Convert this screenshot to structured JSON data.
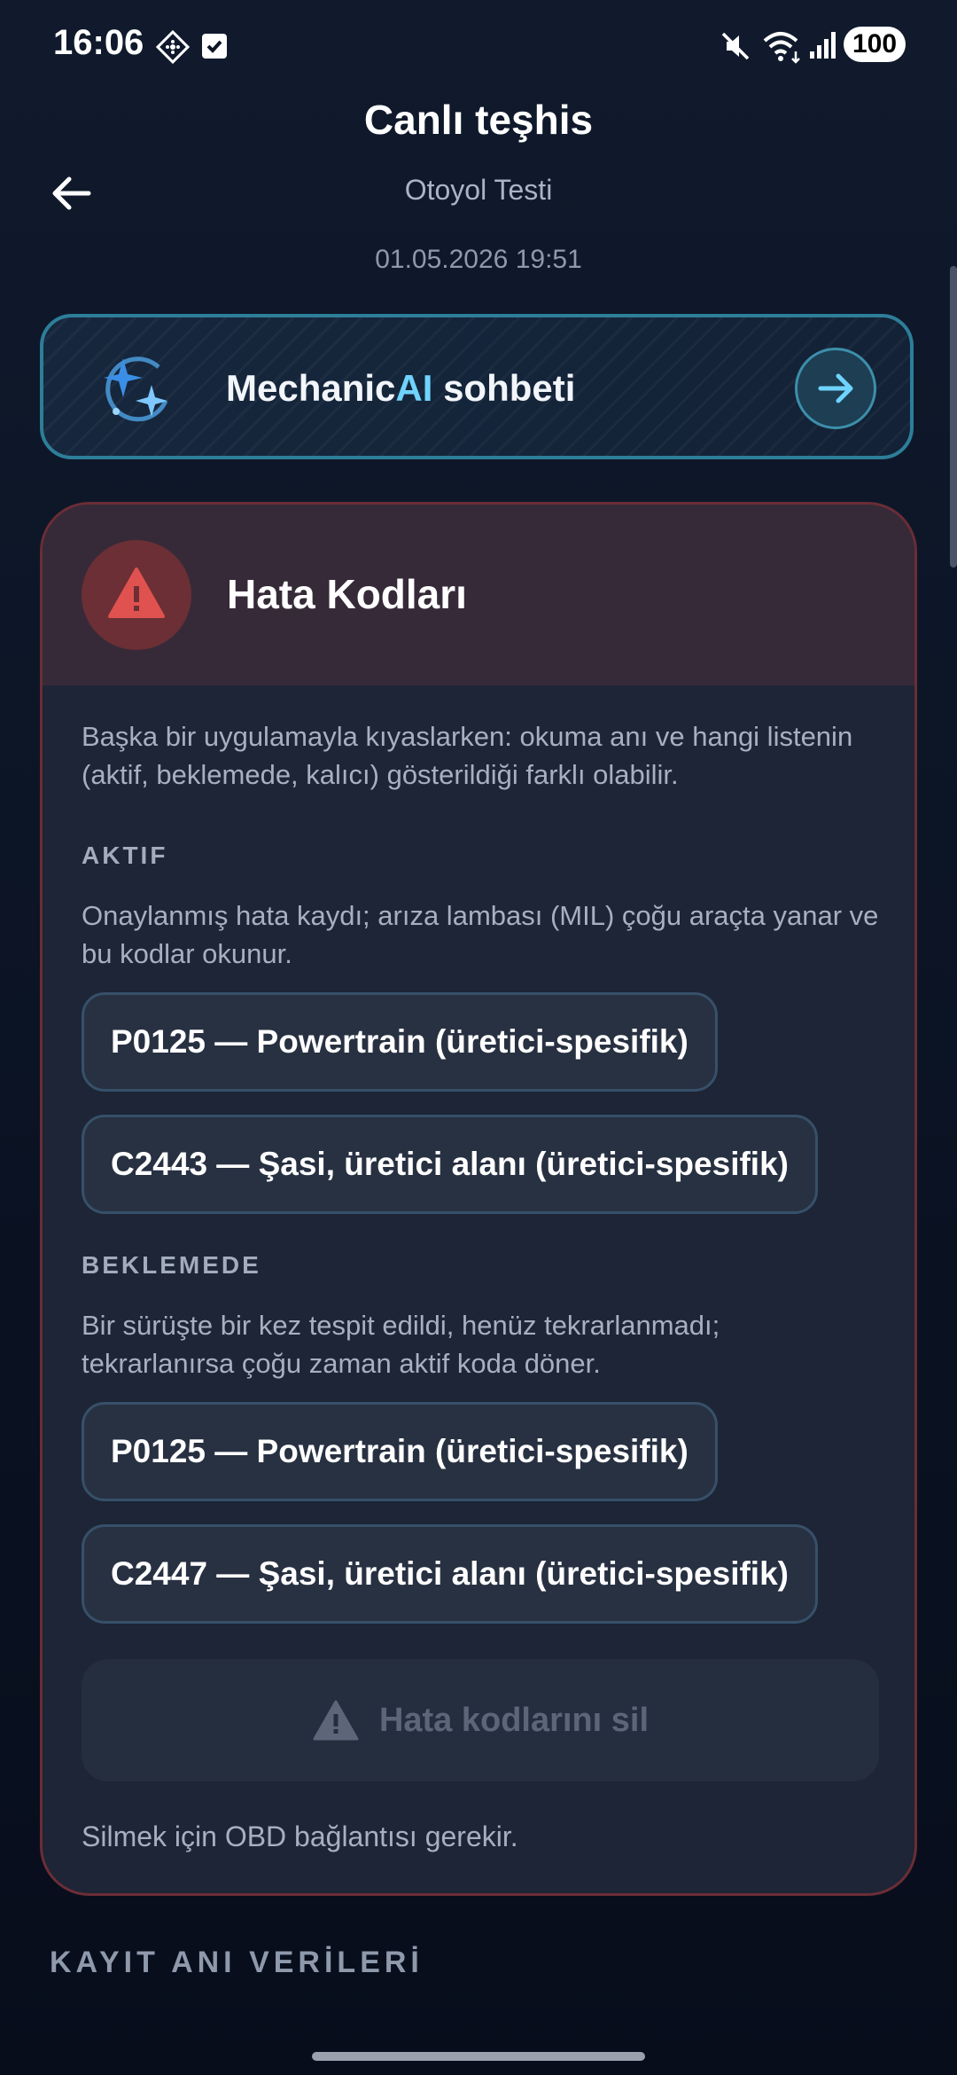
{
  "status_bar": {
    "time": "16:06",
    "battery": "100"
  },
  "header": {
    "title": "Canlı teşhis",
    "subtitle": "Otoyol Testi",
    "datetime": "01.05.2026 19:51"
  },
  "chat_banner": {
    "label_prefix": "Mechanic",
    "label_ai": "AI",
    "label_suffix": " sohbeti"
  },
  "fault_card": {
    "title": "Hata Kodları",
    "intro": "Başka bir uygulamayla kıyaslarken: okuma anı ve hangi listenin (aktif, beklemede, kalıcı) gösterildiği farklı olabilir.",
    "active": {
      "label": "AKTIF",
      "description": "Onaylanmış hata kaydı; arıza lambası (MIL) çoğu araçta yanar ve bu kodlar okunur.",
      "codes": [
        "P0125 — Powertrain (üretici-spesifik)",
        "C2443 — Şasi, üretici alanı (üretici-spesifik)"
      ]
    },
    "pending": {
      "label": "BEKLEMEDE",
      "description": "Bir sürüşte bir kez tespit edildi, henüz tekrarlanmadı; tekrarlanırsa çoğu zaman aktif koda döner.",
      "codes": [
        "P0125 — Powertrain (üretici-spesifik)",
        "C2447 — Şasi, üretici alanı (üretici-spesifik)"
      ]
    },
    "clear_button": "Hata kodlarını sil",
    "clear_note": "Silmek için OBD bağlantısı gerekir."
  },
  "next_section": {
    "label": "KAYIT ANI VERİLERİ"
  },
  "colors": {
    "accent": "#6fd3ff",
    "warning": "#e0524f",
    "card_border": "#6b2d36"
  }
}
